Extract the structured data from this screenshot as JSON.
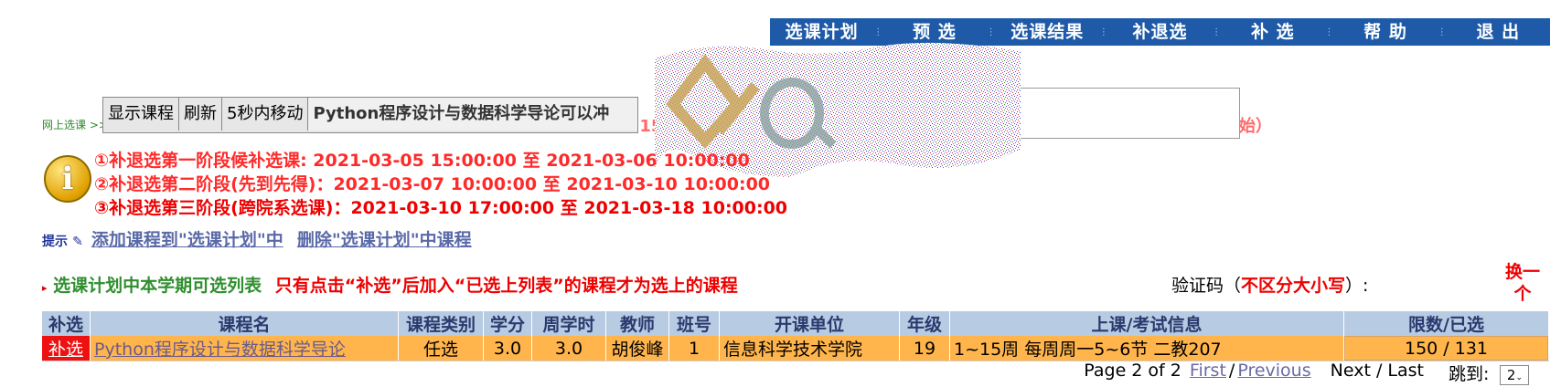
{
  "nav": {
    "items": [
      "选课计划",
      "预 选",
      "选课结果",
      "补退选",
      "补 选",
      "帮 助",
      "退 出"
    ]
  },
  "helper": {
    "show_courses": "显示课程",
    "refresh": "刷新",
    "move": "5秒内移动",
    "message": "Python程序设计与数据科学导论可以冲"
  },
  "breadcrumb": "网上选课 >> 补退选",
  "notice_strip": "补退选时间：2021-03-05 15:00:00至2021-03-18 10:00:00（跨院系选课2021-03-10 17:00:00开始）",
  "phases": [
    "①补退选第一阶段候补选课: 2021-03-05 15:00:00 至 2021-03-06 10:00:00",
    "②补退选第二阶段(先到先得)：2021-03-07 10:00:00 至 2021-03-10 10:00:00",
    "③补退选第三阶段(跨院系选课)：2021-03-10 17:00:00 至 2021-03-18 10:00:00"
  ],
  "tips": {
    "label": "提示",
    "add_link": "添加课程到\"选课计划\"中",
    "remove_link": "删除\"选课计划\"中课程"
  },
  "list": {
    "title": "选课计划中本学期可选列表",
    "note": "只有点击“补选”后加入“已选上列表”的课程才为选上的课程"
  },
  "captcha": {
    "label_prefix": "验证码（",
    "label_emphasis": "不区分大小写",
    "label_suffix": "）:",
    "refresh": "换一个"
  },
  "table": {
    "headers": [
      "补选",
      "课程名",
      "课程类别",
      "学分",
      "周学时",
      "教师",
      "班号",
      "开课单位",
      "年级",
      "上课/考试信息",
      "限数/已选"
    ],
    "rows": [
      {
        "action": "补选",
        "name": "Python程序设计与数据科学导论",
        "category": "任选",
        "credit": "3.0",
        "hours": "3.0",
        "teacher": "胡俊峰",
        "class_no": "1",
        "dept": "信息科学技术学院",
        "grade": "19",
        "schedule": "1~15周 每周周一5~6节 二教207",
        "limit": "150 / 131"
      }
    ]
  },
  "pager": {
    "text": "Page 2 of 2",
    "first": "First",
    "slash": "/",
    "previous": "Previous",
    "next_last": "Next / Last",
    "jump_label": "跳到:",
    "jump_value": "2"
  },
  "colors": {
    "nav_bg": "#1e5aa8",
    "row_bg": "#ffb54c",
    "header_bg": "#b7cbe3",
    "alert_red": "#ee0000",
    "green": "#2f8f2f"
  }
}
